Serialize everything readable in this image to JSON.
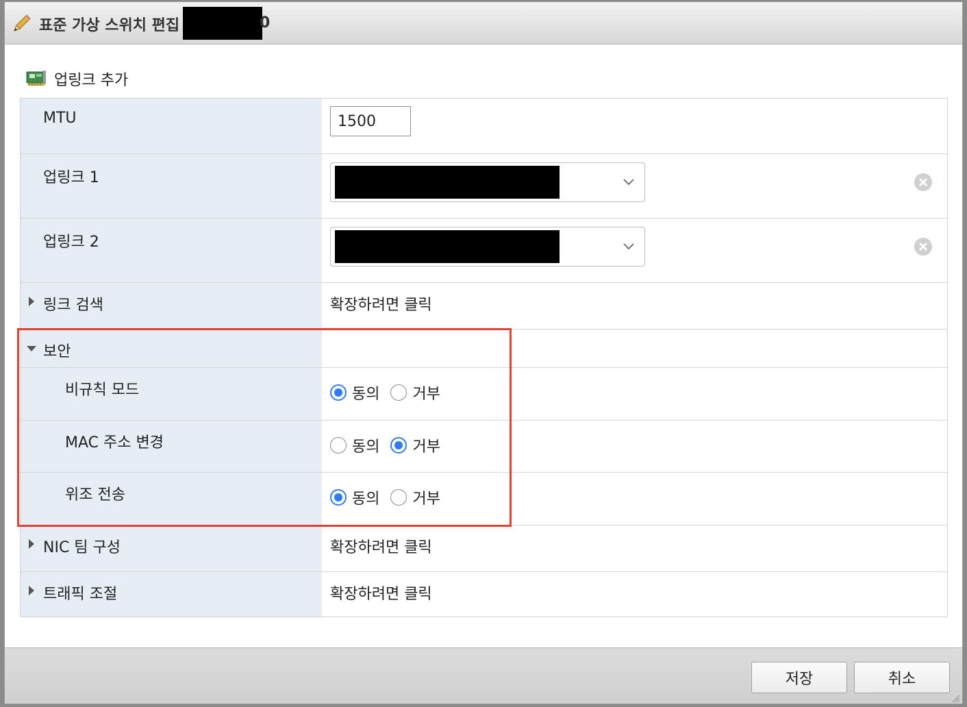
{
  "dialog": {
    "title": "표준 가상 스위치 편집",
    "title_suffix": "0"
  },
  "toolbar": {
    "add_uplink_label": "업링크 추가",
    "add_uplink_icon": "network-card-icon"
  },
  "rows": {
    "mtu": {
      "label": "MTU",
      "value": "1500"
    },
    "uplink1": {
      "label": "업링크 1"
    },
    "uplink2": {
      "label": "업링크 2"
    },
    "link_discovery": {
      "label": "링크 검색",
      "value": "확장하려면 클릭",
      "expanded": false
    },
    "security": {
      "label": "보안",
      "expanded": true,
      "promiscuous": {
        "label": "비규칙 모드",
        "selected": "accept"
      },
      "mac_change": {
        "label": "MAC 주소 변경",
        "selected": "reject"
      },
      "forged_transmit": {
        "label": "위조 전송",
        "selected": "accept"
      }
    },
    "nic_teaming": {
      "label": "NIC 팀 구성",
      "value": "확장하려면 클릭",
      "expanded": false
    },
    "traffic_shaping": {
      "label": "트래픽 조절",
      "value": "확장하려면 클릭",
      "expanded": false
    }
  },
  "radio_labels": {
    "accept": "동의",
    "reject": "거부"
  },
  "footer": {
    "save_label": "저장",
    "cancel_label": "취소"
  },
  "colors": {
    "accent": "#2f7bf6",
    "highlight_box": "#e0412f",
    "label_cell_bg": "#e6edf5"
  }
}
